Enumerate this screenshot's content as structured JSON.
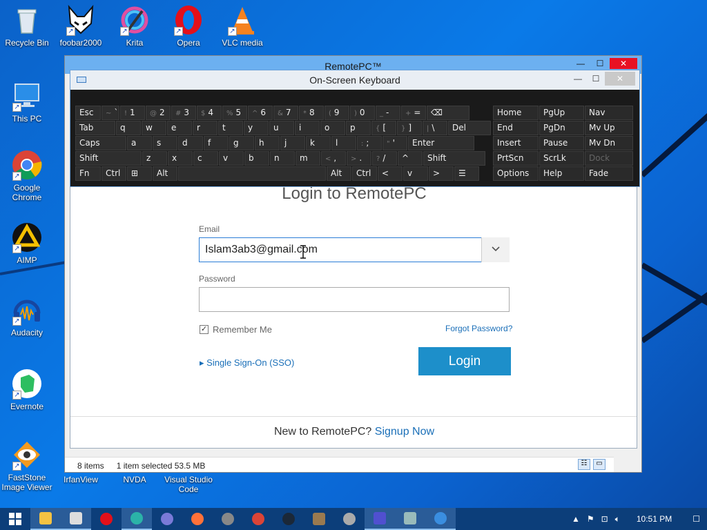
{
  "desktop": {
    "icons": [
      {
        "label": "Recycle Bin"
      },
      {
        "label": "foobar2000"
      },
      {
        "label": "Krita"
      },
      {
        "label": "Opera"
      },
      {
        "label": "VLC media"
      },
      {
        "label": "This PC"
      },
      {
        "label": "Google Chrome"
      },
      {
        "label": "AIMP"
      },
      {
        "label": "Audacity"
      },
      {
        "label": "Evernote"
      },
      {
        "label": "FastStone Image Viewer"
      },
      {
        "label": "IrfanView"
      },
      {
        "label": "NVDA"
      },
      {
        "label": "Visual Studio Code"
      }
    ]
  },
  "explorer": {
    "title": "RemotePC™",
    "status_items": "8 items",
    "status_selected": "1 item selected  53.5 MB"
  },
  "osk": {
    "title": "On-Screen Keyboard",
    "row1": [
      {
        "label": "Esc"
      },
      {
        "sec": "~",
        "label": "`"
      },
      {
        "sec": "!",
        "label": "1"
      },
      {
        "sec": "@",
        "label": "2"
      },
      {
        "sec": "#",
        "label": "3"
      },
      {
        "sec": "$",
        "label": "4"
      },
      {
        "sec": "%",
        "label": "5"
      },
      {
        "sec": "^",
        "label": "6"
      },
      {
        "sec": "&",
        "label": "7"
      },
      {
        "sec": "*",
        "label": "8"
      },
      {
        "sec": "(",
        "label": "9"
      },
      {
        "sec": ")",
        "label": "0"
      },
      {
        "sec": "_",
        "label": "-"
      },
      {
        "sec": "+",
        "label": "="
      },
      {
        "label": "⌫"
      }
    ],
    "row2": [
      {
        "label": "Tab"
      },
      {
        "label": "q"
      },
      {
        "label": "w"
      },
      {
        "label": "e"
      },
      {
        "label": "r"
      },
      {
        "label": "t"
      },
      {
        "label": "y"
      },
      {
        "label": "u"
      },
      {
        "label": "i"
      },
      {
        "label": "o"
      },
      {
        "label": "p"
      },
      {
        "sec": "{",
        "label": "["
      },
      {
        "sec": "}",
        "label": "]"
      },
      {
        "sec": "|",
        "label": "\\"
      },
      {
        "label": "Del"
      }
    ],
    "row3": [
      {
        "label": "Caps"
      },
      {
        "label": "a"
      },
      {
        "label": "s"
      },
      {
        "label": "d"
      },
      {
        "label": "f"
      },
      {
        "label": "g"
      },
      {
        "label": "h"
      },
      {
        "label": "j"
      },
      {
        "label": "k"
      },
      {
        "label": "l"
      },
      {
        "sec": ":",
        "label": ";"
      },
      {
        "sec": "\"",
        "label": "'"
      },
      {
        "label": "Enter"
      }
    ],
    "row4": [
      {
        "label": "Shift"
      },
      {
        "label": "z"
      },
      {
        "label": "x"
      },
      {
        "label": "c"
      },
      {
        "label": "v"
      },
      {
        "label": "b"
      },
      {
        "label": "n"
      },
      {
        "label": "m"
      },
      {
        "sec": "<",
        "label": ","
      },
      {
        "sec": ">",
        "label": "."
      },
      {
        "sec": "?",
        "label": "/"
      },
      {
        "label": "^"
      },
      {
        "label": "Shift"
      }
    ],
    "row5": [
      {
        "label": "Fn"
      },
      {
        "label": "Ctrl"
      },
      {
        "label": "⊞"
      },
      {
        "label": "Alt"
      },
      {
        "label": ""
      },
      {
        "label": "Alt"
      },
      {
        "label": "Ctrl"
      },
      {
        "label": "<"
      },
      {
        "label": "v"
      },
      {
        "label": ">"
      },
      {
        "label": "☰"
      }
    ],
    "nav": [
      [
        "Home",
        "PgUp",
        "Nav"
      ],
      [
        "End",
        "PgDn",
        "Mv Up"
      ],
      [
        "Insert",
        "Pause",
        "Mv Dn"
      ],
      [
        "PrtScn",
        "ScrLk",
        "Dock"
      ],
      [
        "Options",
        "Help",
        "Fade"
      ]
    ]
  },
  "login": {
    "heading": "Login to RemotePC",
    "email_label": "Email",
    "email_value": "Islam3ab3@gmail.com",
    "password_label": "Password",
    "password_value": "",
    "remember_label": "Remember Me",
    "remember_checked": true,
    "forgot_label": "Forgot Password?",
    "sso_label": "Single Sign-On (SSO)",
    "login_button": "Login",
    "signup_prefix": "New to RemotePC?",
    "signup_link": "Signup Now",
    "colors": {
      "accent": "#1d8fca",
      "link": "#1a6fb8"
    }
  },
  "taskbar": {
    "icons": [
      "windows-icon",
      "file-explorer-icon",
      "media-icon",
      "opera-icon",
      "edge-icon",
      "foobar-icon",
      "firefox-icon",
      "app-icon",
      "chrome-icon",
      "steam-icon",
      "gimp-icon",
      "vlc-icon",
      "settings-icon",
      "keyboard-icon",
      "remotepc-icon"
    ],
    "time": "10:51 PM"
  }
}
